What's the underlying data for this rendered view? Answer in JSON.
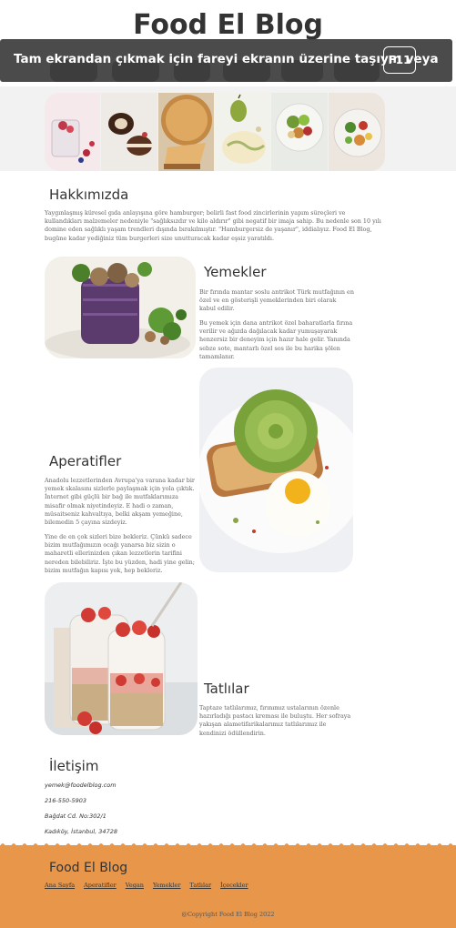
{
  "site": {
    "title": "Food El Blog"
  },
  "fullscreen_banner": {
    "message": "Tam ekrandan çıkmak için fareyi ekranın üzerine taşıyın veya",
    "key": "F11"
  },
  "gallery": {
    "images": [
      "berry-jar-photo",
      "chocolate-roll-photo",
      "pie-slice-photo",
      "pear-plate-photo",
      "salad-bowl-photo",
      "vegetable-dish-photo"
    ]
  },
  "about": {
    "heading": "Hakkımızda",
    "text": "Yaygınlaşmış küresel gıda anlayışına göre hamburger; belirli fast food zincirlerinin yapım süreçleri ve kullandıkları malzemeler nedeniyle \"sağlıksızdır ve kilo aldırır\" gibi negatif bir imaja sahip. Bu nedenle son 10 yılı domine eden sağlıklı yaşam trendleri dışında bırakılmıştır. \"Hamburgersiz de yaşanır\", iddialıyız. Food El Blog, bugüne kadar yediğiniz tüm burgerleri size unutturacak kadar eşsiz yaratıldı."
  },
  "meals": {
    "heading": "Yemekler",
    "p1": "Bir fırında mantar soslu antrikot Türk mutfağının en özel ve en gösterişli yemeklerinden biri olarak kabul edilir.",
    "p2": "Bu yemek için dana antrikot özel baharatlarla fırına verilir ve ağızda dağılacak kadar yumuşayarak henzersiz bir deneyim için hazır hale gelir. Yanında sebze sote, mantarlı özel sos ile bu harika şölen tamamlanır."
  },
  "appetizers": {
    "heading": "Aperatifler",
    "p1": "Anadolu lezzetlerinden Avrupa'ya varana kadar bir yemek skalasını sizlerle paylaşmak için yola çıktık. İnternet gibi güçlü bir bağ ile mutfaklarımıza misafir olmak niyetindeyiz. E hadi o zaman, müsaitseniz kahvaltıya, belki akşam yemeğine, bilemedin 5 çayına sizdeyiz.",
    "p2": "Yine de en çok sizleri bize bekleriz. Çünkü sadece bizim mutfağımızın ocağı yanarsa biz sizin o maharetli ellerinizden çıkan lezzetlerin tarifini nereden bilebiliriz. İşte bu yüzden, hadi yine gelin; bizim mutfağın kapısı yok, hep bekleriz."
  },
  "desserts": {
    "heading": "Tatlılar",
    "p1": "Taptaze tatlılarımız, fırınımız ustalarının özenle hazırladığı pastacı kreması ile buluştu. Her sofraya yakışan alametifarikalarımız tatlılarımız ile kendinizi ödüllendirin."
  },
  "contact": {
    "heading": "İletişim",
    "email": "yemek@foodelblog.com",
    "phone": "216-550-5903",
    "address": "Bağdat Cd. No:302/1",
    "city": "Kadıköy, İstanbul, 34728"
  },
  "footer": {
    "title": "Food El Blog",
    "links": [
      "Ana Sayfa",
      "Aperatifler",
      "Vegan",
      "Yemekler",
      "Tatlılar",
      "İçecekler"
    ],
    "copyright": "@Copyright Food El Blog 2022"
  },
  "colors": {
    "footer_bg": "#e8964a",
    "banner_bg": "#3c3c3c",
    "gallery_band": "#f2f2f2"
  }
}
